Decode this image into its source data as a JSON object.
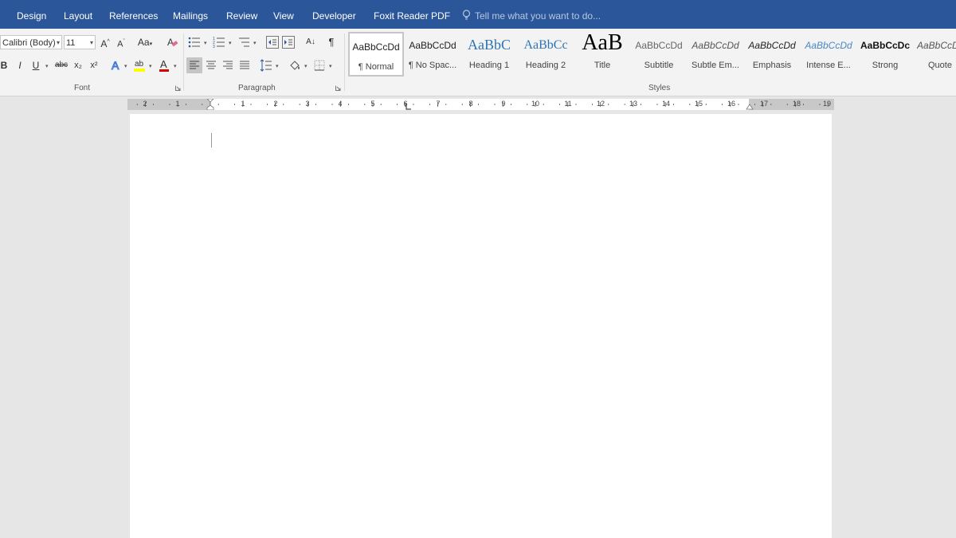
{
  "menubar": {
    "tabs": [
      "Design",
      "Layout",
      "References",
      "Mailings",
      "Review",
      "View",
      "Developer",
      "Foxit Reader PDF"
    ],
    "tell_me": "Tell me what you want to do..."
  },
  "ribbon": {
    "font": {
      "font_name": "Calibri (Body)",
      "font_size": "11",
      "grow_label": "A",
      "shrink_label": "A",
      "case_label": "Aa",
      "bold": "B",
      "italic": "I",
      "underline": "U",
      "strike": "abc",
      "subscript": "x₂",
      "superscript": "x²",
      "group_label": "Font"
    },
    "paragraph": {
      "group_label": "Paragraph",
      "sort": "A↓",
      "pilcrow": "¶"
    },
    "styles": {
      "group_label": "Styles",
      "items": [
        {
          "preview": "AaBbCcDd",
          "name": "¶ Normal"
        },
        {
          "preview": "AaBbCcDd",
          "name": "¶ No Spac..."
        },
        {
          "preview": "AaBbC",
          "name": "Heading 1"
        },
        {
          "preview": "AaBbCc",
          "name": "Heading 2"
        },
        {
          "preview": "AaB",
          "name": "Title"
        },
        {
          "preview": "AaBbCcDd",
          "name": "Subtitle"
        },
        {
          "preview": "AaBbCcDd",
          "name": "Subtle Em..."
        },
        {
          "preview": "AaBbCcDd",
          "name": "Emphasis"
        },
        {
          "preview": "AaBbCcDd",
          "name": "Intense E..."
        },
        {
          "preview": "AaBbCcDc",
          "name": "Strong"
        },
        {
          "preview": "AaBbCcDc",
          "name": "Quote"
        }
      ]
    }
  },
  "ruler": {
    "left_numbers": [
      "2",
      "1"
    ],
    "numbers": [
      "1",
      "2",
      "3",
      "4",
      "5",
      "6",
      "7",
      "8",
      "9",
      "10",
      "11",
      "12",
      "13",
      "14",
      "15",
      "16",
      "17",
      "18",
      "19"
    ]
  },
  "colors": {
    "accent": "#2b579a",
    "highlight": "#ffff00",
    "font_color": "#d20000"
  }
}
